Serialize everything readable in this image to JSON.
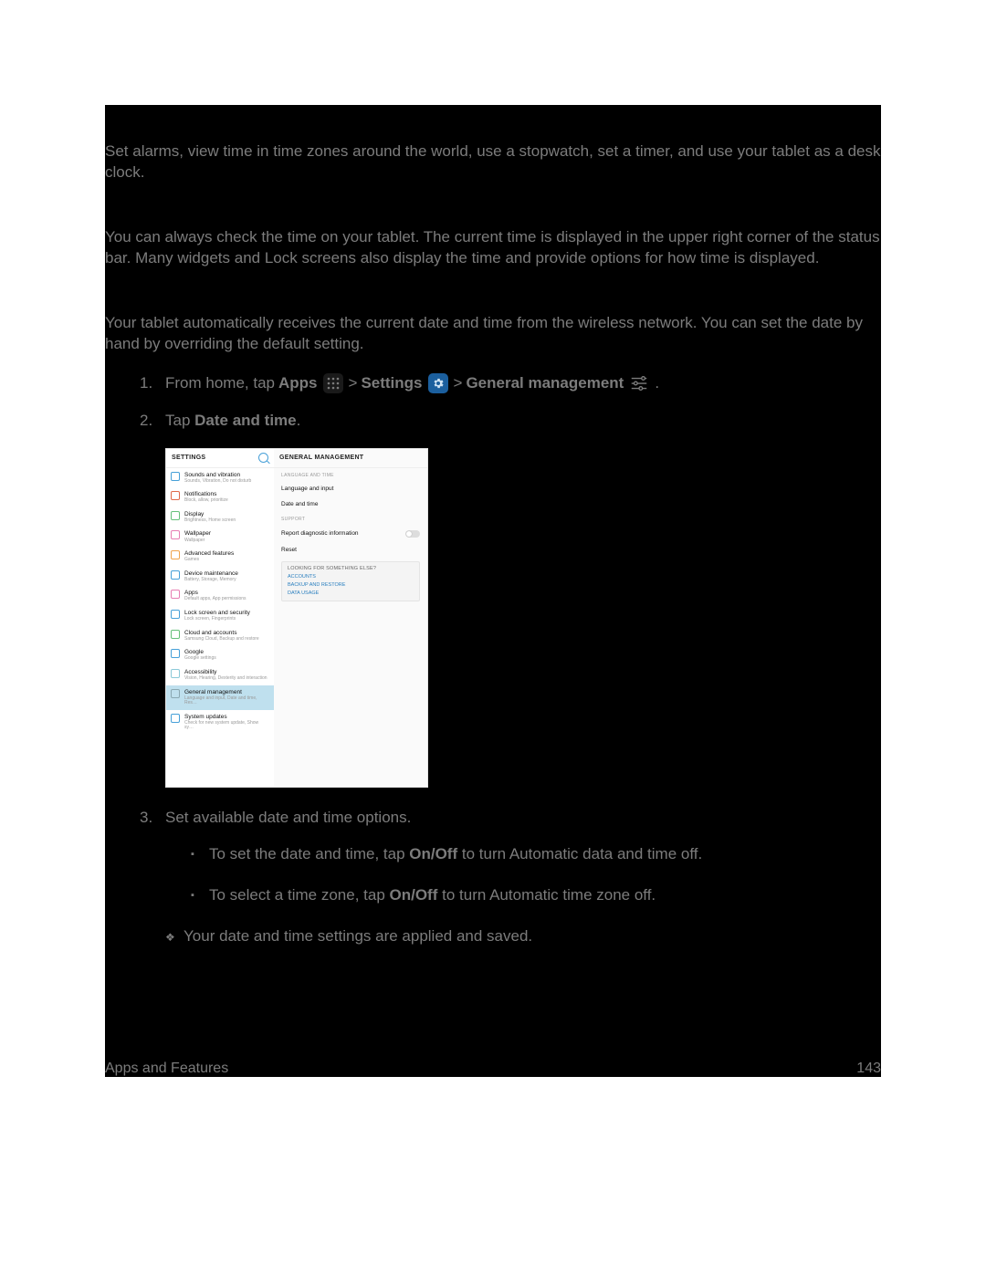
{
  "intro": "Set alarms, view time in time zones around the world, use a stopwatch, set a timer, and use your tablet as a desk clock.",
  "sec1": "You can always check the time on your tablet. The current time is displayed in the upper right corner of the status bar. Many widgets and Lock screens also display the time and provide options for how time is displayed.",
  "sec2": "Your tablet automatically receives the current date and time from the wireless network. You can set the date by hand by overriding the default setting.",
  "step1": {
    "a": "From home, tap ",
    "apps": "Apps",
    "b": " > ",
    "settings": "Settings",
    "c": " > ",
    "gm": "General management",
    "d": "."
  },
  "step2a": "Tap ",
  "step2b": "Date and time",
  "step2c": ".",
  "step3": "Set available date and time options.",
  "bullet1a": "To set the date and time, tap ",
  "bullet1b": "On/Off",
  "bullet1c": " to turn Automatic data and time off.",
  "bullet2a": "To select a time zone, tap ",
  "bullet2b": "On/Off",
  "bullet2c": " to turn Automatic time zone off.",
  "result": "Your date and time settings are applied and saved.",
  "footerLeft": "Apps and Features",
  "footerRight": "143",
  "shot": {
    "leftTitle": "SETTINGS",
    "rightTitle": "GENERAL MANAGEMENT",
    "items": [
      {
        "t": "Sounds and vibration",
        "s": "Sounds, Vibration, Do not disturb",
        "c": "#46a0d8"
      },
      {
        "t": "Notifications",
        "s": "Block, allow, prioritize",
        "c": "#e06a4a"
      },
      {
        "t": "Display",
        "s": "Brightness, Home screen",
        "c": "#66c07a"
      },
      {
        "t": "Wallpaper",
        "s": "Wallpaper",
        "c": "#e77fb3"
      },
      {
        "t": "Advanced features",
        "s": "Games",
        "c": "#f0a44c"
      },
      {
        "t": "Device maintenance",
        "s": "Battery, Storage, Memory",
        "c": "#46a0d8"
      },
      {
        "t": "Apps",
        "s": "Default apps, App permissions",
        "c": "#e77fb3"
      },
      {
        "t": "Lock screen and security",
        "s": "Lock screen, Fingerprints",
        "c": "#46a0d8"
      },
      {
        "t": "Cloud and accounts",
        "s": "Samsung Cloud, Backup and restore",
        "c": "#66c07a"
      },
      {
        "t": "Google",
        "s": "Google settings",
        "c": "#46a0d8"
      },
      {
        "t": "Accessibility",
        "s": "Vision, Hearing, Dexterity and interaction",
        "c": "#8cc9d8"
      },
      {
        "t": "General management",
        "s": "Language and input, Date and time, Res…",
        "c": "#8aa8b2",
        "sel": true
      },
      {
        "t": "System updates",
        "s": "Check for new system update, Show sy…",
        "c": "#46a0d8"
      }
    ],
    "rs1": "LANGUAGE AND TIME",
    "r1": "Language and input",
    "r2": "Date and time",
    "rs2": "SUPPORT",
    "r3": "Report diagnostic information",
    "r4": "Reset",
    "cardTitle": "LOOKING FOR SOMETHING ELSE?",
    "cardLinks": [
      "ACCOUNTS",
      "BACKUP AND RESTORE",
      "DATA USAGE"
    ]
  }
}
